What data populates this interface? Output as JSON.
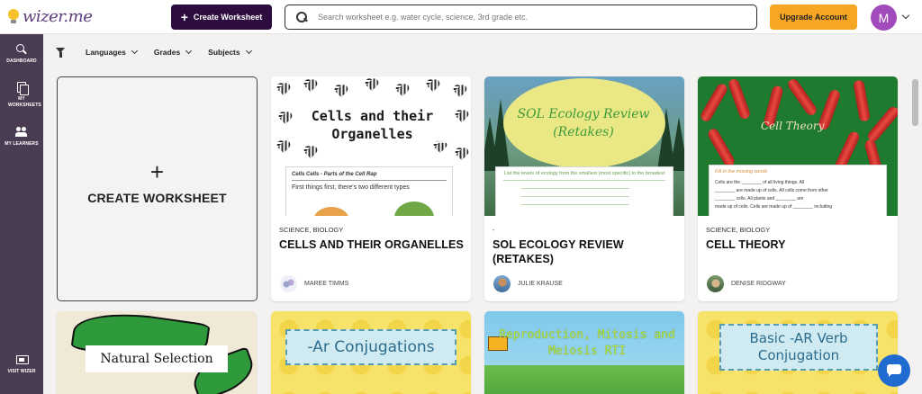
{
  "header": {
    "logo_text": "wizer.me",
    "create_label": "Create Worksheet",
    "search_placeholder": "Search worksheet e.g. water cycle, science, 3rd grade etc.",
    "upgrade_label": "Upgrade Account",
    "avatar_initial": "M",
    "brand_color": "#2d0c3f",
    "accent_color": "#f6a623",
    "avatar_color": "#a24bbd"
  },
  "sidebar": {
    "bg_color": "#4a3c52",
    "items": [
      {
        "icon": "search-icon",
        "label": "DASHBOARD"
      },
      {
        "icon": "copy-icon",
        "label": "MY WORKSHEETS"
      },
      {
        "icon": "people-icon",
        "label": "MY LEARNERS"
      },
      {
        "icon": "chat-icon",
        "label": "VISIT WIZER"
      }
    ]
  },
  "filters": [
    "Languages",
    "Grades",
    "Subjects"
  ],
  "create_card": {
    "plus": "+",
    "label": "CREATE WORKSHEET"
  },
  "cards": [
    {
      "subject": "SCIENCE, BIOLOGY",
      "title": "CELLS AND THEIR ORGANELLES",
      "author": "MAREE TIMMS",
      "thumb_title": "Cells and their Organelles",
      "thumb_header": "Cells Cells - Parts of the Cell Rap",
      "thumb_line": "First things first, there's two different types"
    },
    {
      "subject": "-",
      "title": "SOL ECOLOGY REVIEW (RETAKES)",
      "author": "JULIE KRAUSE",
      "thumb_title": "SOL Ecology Review (Retakes)",
      "thumb_header": "List the levels of ecology from the smallest (most specific) to the broadest"
    },
    {
      "subject": "SCIENCE, BIOLOGY",
      "title": "CELL THEORY",
      "author": "DENISE RIDGWAY",
      "thumb_title": "Cell Theory",
      "thumb_header": "Fill in the missing words",
      "thumb_lines": [
        "Cells are the ________ of all living things. All",
        "________ are made up of cells. All cells come from other",
        "________ cells. All plants and ________ are",
        "made up of cells. Cells are made up of ________ including"
      ]
    }
  ],
  "row2_thumbs": [
    {
      "thumb_title": "Natural Selection"
    },
    {
      "thumb_title": "-Ar Conjugations"
    },
    {
      "thumb_title": "Reproduction, Mitosis and Meiosis RTI"
    },
    {
      "thumb_title": "Basic -AR Verb Conjugation"
    }
  ]
}
